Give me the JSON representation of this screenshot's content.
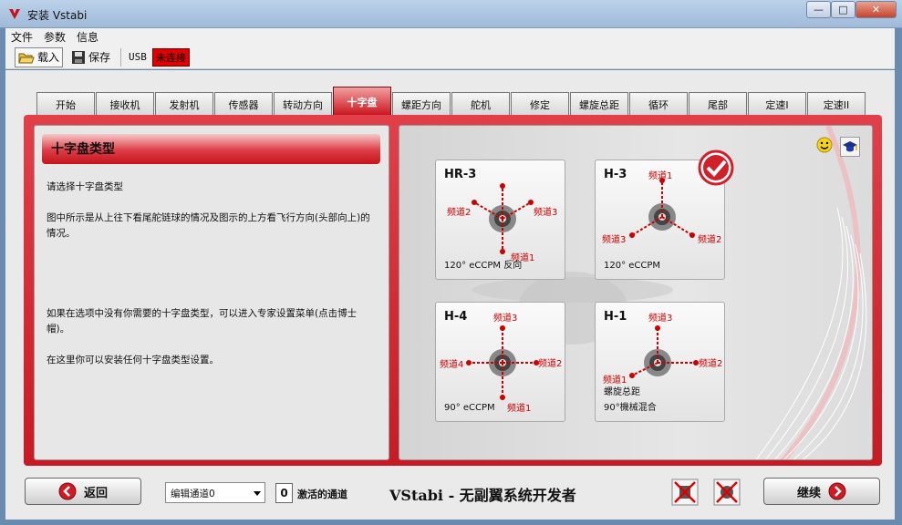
{
  "window": {
    "title": "安装 Vstabi",
    "minimize": "—",
    "maximize": "□",
    "close": "✕"
  },
  "menu": [
    "文件",
    "参数",
    "信息"
  ],
  "toolbar": {
    "load": "载入",
    "save": "保存",
    "usb": "USB",
    "connection": "未连接"
  },
  "tabs": [
    "开始",
    "接收机",
    "发射机",
    "传感器",
    "转动方向",
    "十字盘",
    "螺距方向",
    "舵机",
    "修定",
    "螺旋总距",
    "循环",
    "尾部",
    "定速I",
    "定速II"
  ],
  "active_tab": "十字盘",
  "left": {
    "header": "十字盘类型",
    "p1": "请选择十字盘类型",
    "p2": "图中所示是从上往下看尾舵链球的情况及图示的上方看飞行方向(头部向上)的情况。",
    "p3": "如果在选项中没有你需要的十字盘类型，可以进入专家设置菜单(点击博士帽)。",
    "p4": "在这里你可以安装任何十字盘类型设置。"
  },
  "cards": {
    "hr3": {
      "title": "HR-3",
      "caption": "120° eCCPM 反向",
      "ch1": "频道1",
      "ch2": "频道2",
      "ch3": "频道3"
    },
    "h3": {
      "title": "H-3",
      "caption": "120° eCCPM",
      "ch1": "频道1",
      "ch2": "频道2",
      "ch3": "频道3"
    },
    "h4": {
      "title": "H-4",
      "caption": "90° eCCPM",
      "ch1": "频道1",
      "ch2": "频道2",
      "ch3": "频道3",
      "ch4": "频道4"
    },
    "h1": {
      "title": "H-1",
      "caption1": "螺旋总距",
      "caption2": "90°機械混合",
      "ch1": "频道1",
      "ch2": "频道2",
      "ch3": "频道3"
    }
  },
  "bottom": {
    "back": "返回",
    "next": "继续",
    "channel_select": "编辑通道0",
    "active_count": "0",
    "active_label": "激活的通道",
    "brand": "VStabi - 无副翼系统开发者"
  }
}
